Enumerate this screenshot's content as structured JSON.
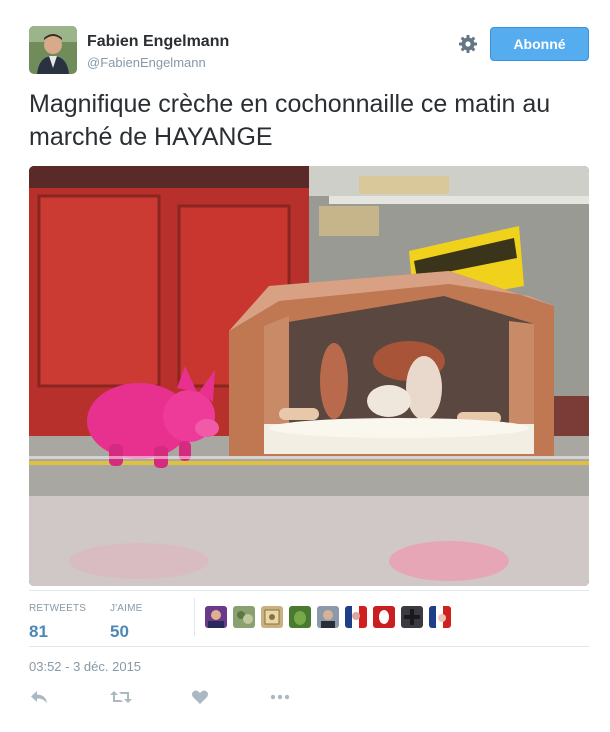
{
  "tweet": {
    "author_name": "Fabien Engelmann",
    "author_handle": "@FabienEngelmann",
    "follow_label": "Abonné",
    "text": "Magnifique crèche en cochonnaille ce matin au marché de HAYANGE",
    "retweets_label": "RETWEETS",
    "retweets_count": "81",
    "likes_label": "J'AIME",
    "likes_count": "50",
    "timestamp": "03:52 - 3 déc. 2015"
  },
  "icons": {
    "settings": "gear-icon",
    "reply": "reply-icon",
    "retweet": "retweet-icon",
    "like": "heart-icon",
    "more": "more-icon"
  },
  "colors": {
    "accent": "#55acee",
    "stat_value": "#4c88b5",
    "muted": "#8899a6",
    "text": "#292f33"
  }
}
